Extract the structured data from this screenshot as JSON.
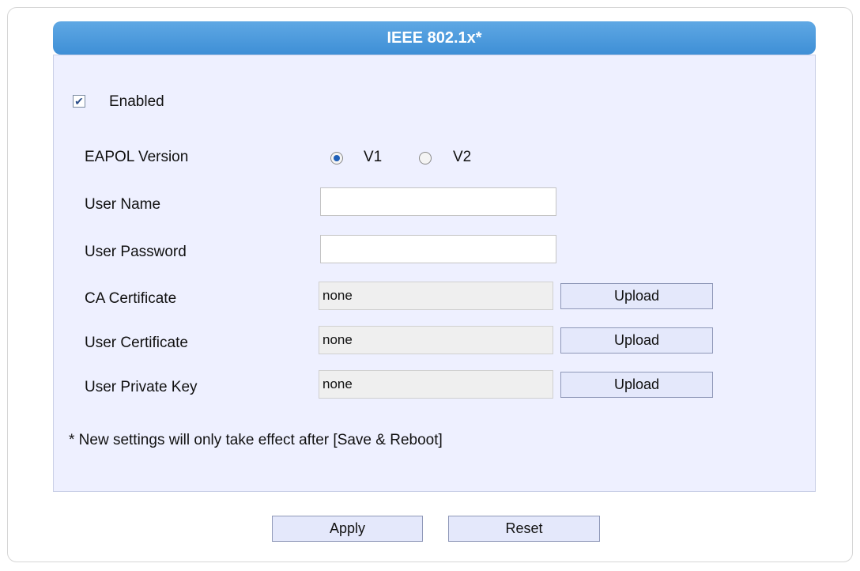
{
  "header": {
    "title": "IEEE 802.1x*"
  },
  "enabled": {
    "label": "Enabled",
    "checked": true
  },
  "eapol": {
    "label": "EAPOL Version",
    "options": [
      {
        "label": "V1",
        "selected": true
      },
      {
        "label": "V2",
        "selected": false
      }
    ]
  },
  "user_name": {
    "label": "User Name",
    "value": ""
  },
  "user_password": {
    "label": "User Password",
    "value": ""
  },
  "certs": [
    {
      "label": "CA Certificate",
      "value": "none",
      "button": "Upload"
    },
    {
      "label": "User Certificate",
      "value": "none",
      "button": "Upload"
    },
    {
      "label": "User Private Key",
      "value": "none",
      "button": "Upload"
    }
  ],
  "note": "* New settings will only take effect after [Save & Reboot]",
  "actions": {
    "apply": "Apply",
    "reset": "Reset"
  },
  "colors": {
    "header": "#3e8fd6",
    "panel": "#eef0ff",
    "button": "#e4e8fb"
  }
}
